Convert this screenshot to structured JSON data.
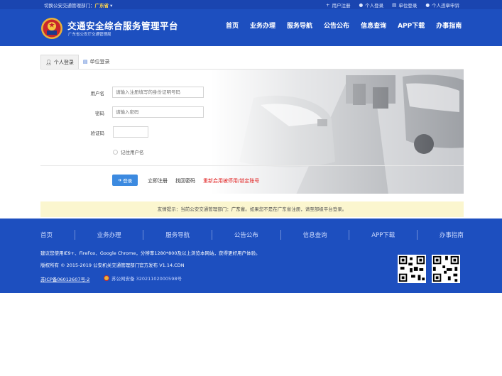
{
  "topbar": {
    "switch_prefix": "切换公安交通管理部门：",
    "city": "广东省",
    "links": [
      "用户注册",
      "个人登录",
      "单位登录",
      "个人违章申诉"
    ]
  },
  "header": {
    "title": "交通安全综合服务管理平台",
    "subtitle": "广东省公安厅交通管理局",
    "nav": [
      "首页",
      "业务办理",
      "服务导航",
      "公告公布",
      "信息查询",
      "APP下载",
      "办事指南"
    ]
  },
  "tabs": [
    "个人登录",
    "单位登录"
  ],
  "form": {
    "username_label": "用户名",
    "username_placeholder": "请输入注册填写的身份证明号码",
    "password_label": "密码",
    "password_placeholder": "请输入密码",
    "captcha_label": "验证码",
    "remember_label": "记住用户名",
    "login_button": "登录",
    "register_link": "立即注册",
    "recover_link": "找回密码",
    "reactivate_link": "重新启用被停用/锁定账号"
  },
  "notice": {
    "prefix": "友情提示：当前公安交通管理部门：",
    "city": "广东省",
    "suffix": "。如果您不是在广东省注册，请至部级平台登录。"
  },
  "footer": {
    "nav": [
      "首页",
      "业务办理",
      "服务导航",
      "公告公布",
      "信息查询",
      "APP下载",
      "办事指南"
    ],
    "browser_note": "建议您使用IE9+、FireFox、Google Chrome，分辨率1280*800及以上浏览本网站，获得更好用户体验。",
    "copyright": "版权所有 © 2015-2019 公安机关交通管理部门官方发布 V1.14.CDN",
    "icp": "苏ICP备06012607号-2",
    "police_record": "苏公网安备 32021102000598号"
  },
  "colors": {
    "brand_blue": "#1d4fbf",
    "topbar_blue": "#1a45b0",
    "button_blue": "#3c8ae0",
    "notice_bg": "#fbf6cf",
    "warning_red": "#e02020",
    "city_yellow": "#ffd54a"
  }
}
